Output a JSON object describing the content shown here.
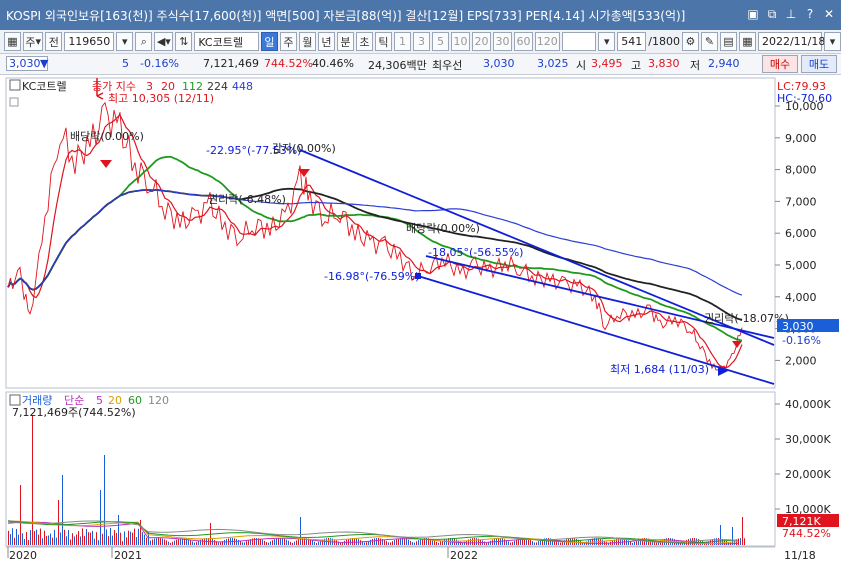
{
  "titlebar": {
    "title": "KOSPI 외국인보유[163(천)] 주식수[17,600(천)] 액면[500] 자본금[88(억)] 결산[12월] EPS[733] PER[4.14] 시가총액[533(억)]",
    "icons": [
      "window-icon",
      "copy-icon",
      "pin-icon",
      "help-icon",
      "close-icon"
    ]
  },
  "toolbar": {
    "market": "주",
    "period": "전",
    "code": "119650",
    "name": "KC코트렐",
    "period_tabs": [
      "일",
      "주",
      "월",
      "년",
      "분",
      "초",
      "틱"
    ],
    "active_period": "일",
    "minute_options": [
      "1",
      "3",
      "5",
      "10",
      "20",
      "30",
      "60",
      "120"
    ],
    "count": "541",
    "total": "/1800",
    "date": "2022/11/18"
  },
  "quote": {
    "price": "3,030",
    "change": "5",
    "change_rate": "-0.16%",
    "volume": "7,121,469",
    "volume_ratio": "744.52%",
    "turnover": "40.46%",
    "amount": "24,306백만",
    "priority_label": "최우선",
    "ask": "3,030",
    "bid": "3,025",
    "open_label": "시",
    "open": "3,495",
    "high_label": "고",
    "high": "3,830",
    "low_label": "저",
    "low": "2,940",
    "buy_label": "매수",
    "sell_label": "매도"
  },
  "price_pane": {
    "stock_label": "KC코트렐",
    "ma_label": "종가 지수",
    "ma_periods": [
      "3",
      "20",
      "112",
      "224",
      "448"
    ],
    "ma_colors": [
      "#e0141e",
      "#e0141e",
      "#1f9a1f",
      "#333333",
      "#2b3fd8"
    ],
    "lc": "LC:79.93",
    "hc": "HC:-70.60",
    "current_price_tag": "3,030",
    "current_change_tag": "-0.16%",
    "y_ticks": [
      "10,000",
      "9,000",
      "8,000",
      "7,000",
      "6,000",
      "5,000",
      "4,000",
      "3,000",
      "2,000"
    ],
    "annotations": {
      "high": "최고 10,305 (12/11)",
      "low": "최저 1,684 (11/03)",
      "div1": "배당락(0.00%)",
      "div2": "배당락(0.00%)",
      "div3": "배당락(0.00%)",
      "rights1": "권리락(-6.48%)",
      "rights2": "권리락(-18.07%)",
      "trend1": "-22.95°(-77.53%)",
      "trend2": "-18.05°(-56.55%)",
      "trend3": "-16.98°(-76.59%)",
      "gam": "감자(0.00%)"
    }
  },
  "volume_pane": {
    "label": "거래량",
    "ma_label": "단순",
    "ma_periods": [
      "5",
      "20",
      "60",
      "120"
    ],
    "ma_colors": [
      "#c030c0",
      "#d8a000",
      "#1f9a1f",
      "#888888"
    ],
    "current": "7,121,469주(744.52%)",
    "y_ticks": [
      "40,000K",
      "30,000K",
      "20,000K",
      "10,000K"
    ],
    "current_tag": "7,121K",
    "current_ratio_tag": "744.52%"
  },
  "x_labels": [
    "2020",
    "2021",
    "2022",
    "11/18"
  ]
}
